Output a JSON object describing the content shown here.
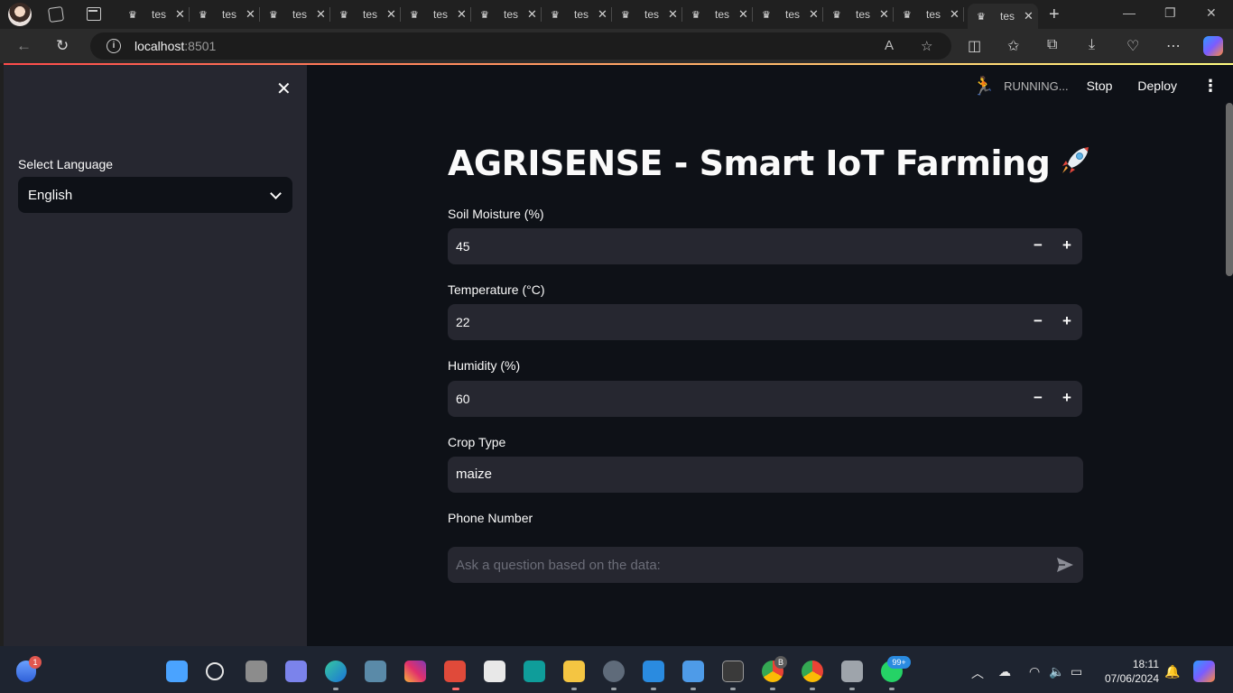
{
  "browser": {
    "tabs": [
      {
        "label": "tes"
      },
      {
        "label": "tes"
      },
      {
        "label": "tes"
      },
      {
        "label": "tes"
      },
      {
        "label": "tes"
      },
      {
        "label": "tes"
      },
      {
        "label": "tes"
      },
      {
        "label": "tes"
      },
      {
        "label": "tes"
      },
      {
        "label": "tes"
      },
      {
        "label": "tes"
      },
      {
        "label": "tes"
      },
      {
        "label": "tes"
      }
    ],
    "url_host": "localhost",
    "url_port": ":8501"
  },
  "header": {
    "status": "RUNNING...",
    "stop_label": "Stop",
    "deploy_label": "Deploy"
  },
  "sidebar": {
    "language_label": "Select Language",
    "language_value": "English"
  },
  "main": {
    "title": "AGRISENSE - Smart IoT Farming",
    "soil_moisture": {
      "label": "Soil Moisture (%)",
      "value": "45"
    },
    "temperature": {
      "label": "Temperature (°C)",
      "value": "22"
    },
    "humidity": {
      "label": "Humidity (%)",
      "value": "60"
    },
    "crop_type": {
      "label": "Crop Type",
      "value": "maize"
    },
    "phone": {
      "label": "Phone Number"
    },
    "chat_placeholder": "Ask a question based on the data:"
  },
  "taskbar": {
    "time": "18:11",
    "date": "07/06/2024",
    "notif_badge": "1",
    "chrome_badge": "B",
    "whatsapp_badge": "99+"
  }
}
